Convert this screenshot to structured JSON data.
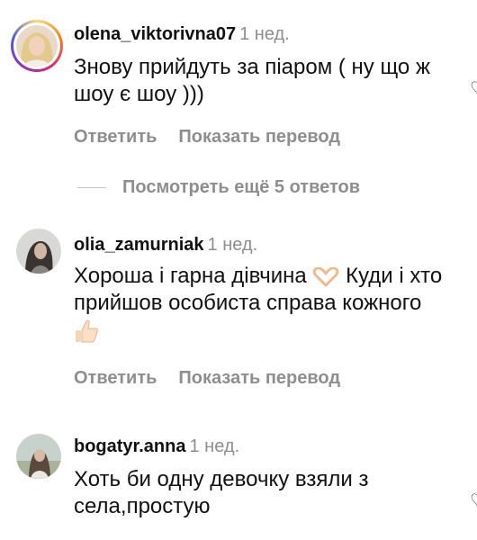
{
  "comments": [
    {
      "username": "olena_viktorivna07",
      "time": "1 нед.",
      "text": "Знову прийдуть за піаром ( ну що ж шоу є шоу )))",
      "reply_label": "Ответить",
      "translate_label": "Показать перевод",
      "has_story_ring": true
    },
    {
      "username": "olia_zamurniak",
      "time": "1 нед.",
      "text_line1": "Хороша і гарна дівчина",
      "text_line2": "Куди і хто прийшов особиста справа кожного",
      "emoji1": "heart-hands-emoji",
      "emoji2": "thumbs-up-emoji",
      "reply_label": "Ответить",
      "translate_label": "Показать перевод"
    },
    {
      "username": "bogatyr.anna",
      "time": "1 нед.",
      "text": "Хоть би одну девочку взяли  з села,простую"
    }
  ],
  "view_replies_label": "Посмотреть ещё 5 ответов",
  "icons": {
    "like": "heart-icon"
  },
  "colors": {
    "secondary_text": "#8e8e8e",
    "primary_text": "#111111"
  }
}
